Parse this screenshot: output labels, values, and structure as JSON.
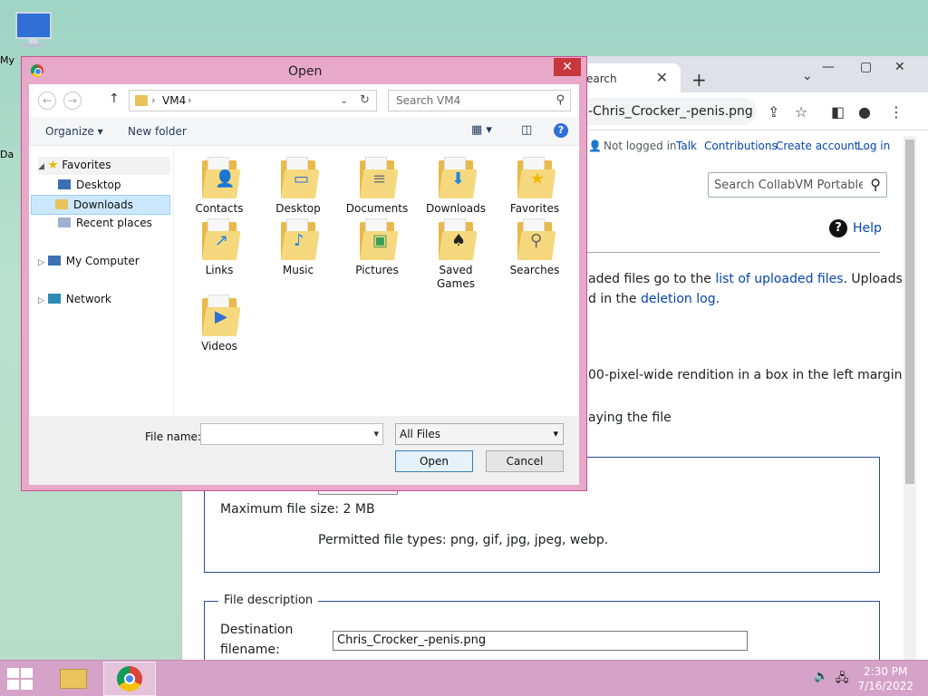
{
  "desktop": {
    "icons": [
      {
        "label": "My"
      },
      {
        "label": "Da"
      }
    ]
  },
  "browser": {
    "tab_title": "earch",
    "new_tab": "+",
    "url": "-Chris_Crocker_-penis.png",
    "personal": {
      "not_logged_in": "Not logged in",
      "talk": "Talk",
      "contributions": "Contributions",
      "create_account": "Create account",
      "log_in": "Log in"
    },
    "search_placeholder": "Search CollabVM Portable W",
    "help": "Help",
    "text": {
      "l1a": "aded files go to the ",
      "l1link": "list of uploaded files",
      "l1b": ". Uploads",
      "l2a": "d in the ",
      "l2link": "deletion log",
      "l2b": ".",
      "l3": "00-pixel-wide rendition in a box in the left margin",
      "l4": "aying the file",
      "max_size": "Maximum file size: 2 MB",
      "permitted": "Permitted file types: png, gif, jpg, jpeg, webp."
    },
    "file_description_legend": "File description",
    "destination_label_1": "Destination",
    "destination_label_2": "filename:",
    "destination_value": "Chris_Crocker_-penis.png"
  },
  "dialog": {
    "title": "Open",
    "close": "✕",
    "address": "VM4",
    "search_placeholder": "Search VM4",
    "organize": "Organize ▾",
    "new_folder": "New folder",
    "tree": {
      "favorites": "Favorites",
      "desktop": "Desktop",
      "downloads": "Downloads",
      "recent": "Recent places",
      "computer": "My Computer",
      "network": "Network"
    },
    "files": [
      {
        "label": "Contacts",
        "badge": "👤"
      },
      {
        "label": "Desktop",
        "badge": "▭"
      },
      {
        "label": "Documents",
        "badge": "≡"
      },
      {
        "label": "Downloads",
        "badge": "⬇"
      },
      {
        "label": "Favorites",
        "badge": "★"
      },
      {
        "label": "Links",
        "badge": "↗"
      },
      {
        "label": "Music",
        "badge": "♪"
      },
      {
        "label": "Pictures",
        "badge": "▣"
      },
      {
        "label": "Saved Games",
        "badge": "♠"
      },
      {
        "label": "Searches",
        "badge": "⚲"
      },
      {
        "label": "Videos",
        "badge": "▶"
      }
    ],
    "file_name_label": "File name:",
    "file_name_value": "",
    "file_type": "All Files",
    "open_button": "Open",
    "cancel_button": "Cancel"
  },
  "taskbar": {
    "time": "2:30 PM",
    "date": "7/16/2022"
  }
}
